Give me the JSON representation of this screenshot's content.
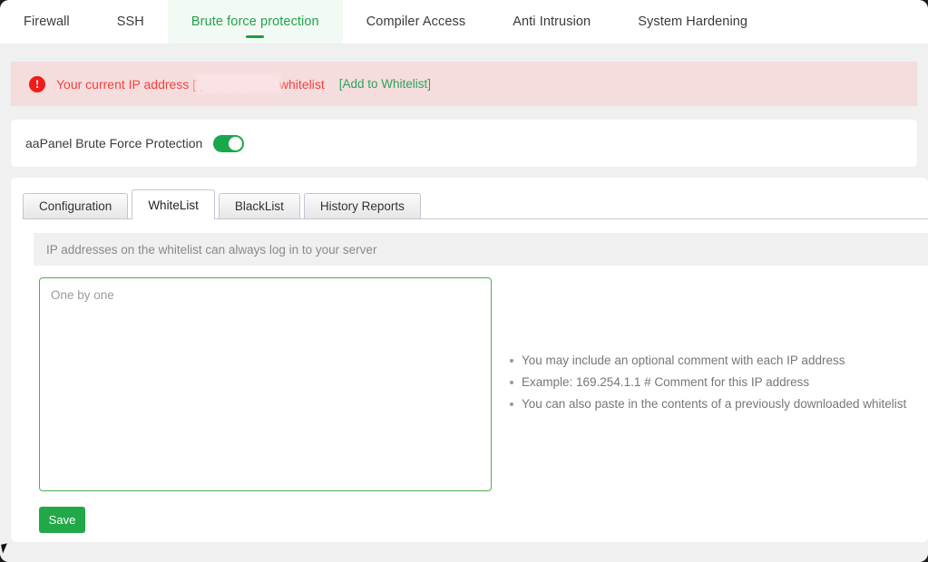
{
  "top_tabs": [
    {
      "label": "Firewall",
      "active": false
    },
    {
      "label": "SSH",
      "active": false
    },
    {
      "label": "Brute force protection",
      "active": true
    },
    {
      "label": "Compiler Access",
      "active": false
    },
    {
      "label": "Anti Intrusion",
      "active": false
    },
    {
      "label": "System Hardening",
      "active": false
    }
  ],
  "alert": {
    "icon": "error-exclamation-icon",
    "text_before": "Your current IP address [",
    "redacted_ip": "",
    "text_after": "] is not on the whitelist",
    "full_text": "Your current IP address [                     ] is not on the whitelist",
    "link_label": "[Add to Whitelist]",
    "bg_color": "#f5dcdd",
    "text_color": "#f2433f",
    "link_color": "#2aa55a"
  },
  "toggle_section": {
    "label": "aaPanel Brute Force Protection",
    "enabled": true,
    "on_color": "#19a74b"
  },
  "sub_tabs": [
    {
      "label": "Configuration",
      "active": false
    },
    {
      "label": "WhiteList",
      "active": true
    },
    {
      "label": "BlackList",
      "active": false
    },
    {
      "label": "History Reports",
      "active": false
    }
  ],
  "hint": "IP addresses on the whitelist can always log in to your server",
  "whitelist_input": {
    "placeholder": "One by one",
    "value": "",
    "border_color": "#4caf50"
  },
  "notes": [
    "You may include an optional comment with each IP address",
    "Example: 169.254.1.1 # Comment for this IP address",
    "You can also paste in the contents of a previously downloaded whitelist"
  ],
  "save_button": {
    "label": "Save",
    "color": "#21a848"
  }
}
